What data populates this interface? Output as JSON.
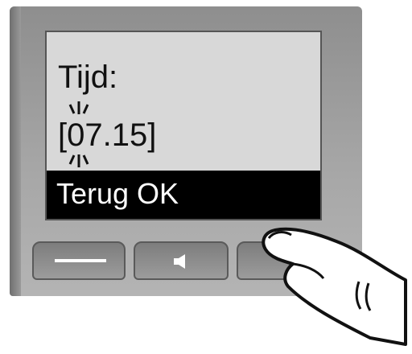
{
  "screen": {
    "label": "Tijd:",
    "time_value": "[07.15]",
    "softkeys_text": "Terug OK"
  },
  "keys": {
    "left": "dash-icon",
    "middle": "speaker-icon",
    "right": "softkey"
  },
  "colors": {
    "screen_bg": "#d8d8d8",
    "softkey_bar": "#000000",
    "device_body": "#a6a6a6"
  }
}
